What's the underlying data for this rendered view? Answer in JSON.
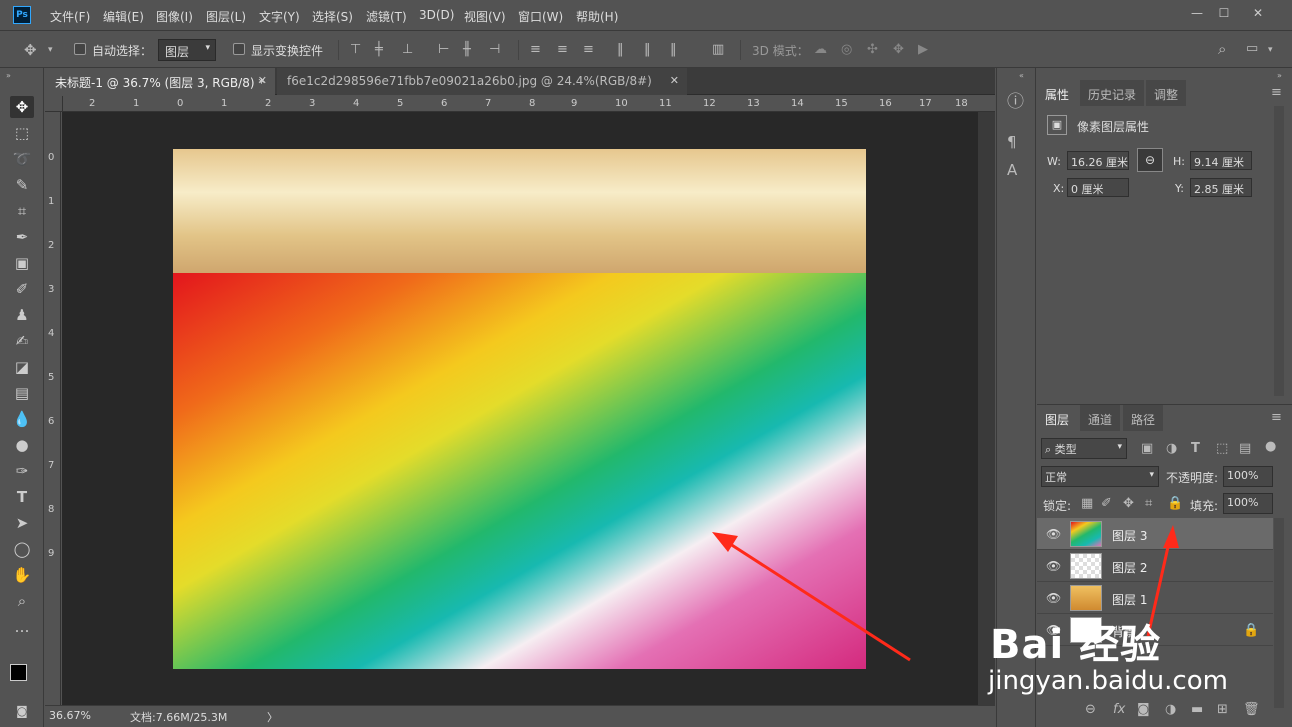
{
  "app": {
    "logo": "Ps"
  },
  "menu": [
    "文件(F)",
    "编辑(E)",
    "图像(I)",
    "图层(L)",
    "文字(Y)",
    "选择(S)",
    "滤镜(T)",
    "3D(D)",
    "视图(V)",
    "窗口(W)",
    "帮助(H)"
  ],
  "window_controls": {
    "minimize": "—",
    "maximize": "☐",
    "close": "✕"
  },
  "options": {
    "auto_select_label": "自动选择：",
    "auto_select_target": "图层",
    "show_transform_label": "显示变换控件",
    "mode3d_label": "3D 模式："
  },
  "tabs": [
    {
      "label": "未标题-1 @ 36.7% (图层 3, RGB/8) *",
      "active": true
    },
    {
      "label": "f6e1c2d298596e71fbb7e09021a26b0.jpg @ 24.4%(RGB/8#)",
      "active": false
    }
  ],
  "ruler_h": [
    "2",
    "1",
    "0",
    "1",
    "2",
    "3",
    "4",
    "5",
    "6",
    "7",
    "8",
    "9",
    "10",
    "11",
    "12",
    "13",
    "14",
    "15",
    "16",
    "17",
    "18"
  ],
  "ruler_v": [
    "0",
    "1",
    "2",
    "3",
    "4",
    "5",
    "6",
    "7",
    "8",
    "9"
  ],
  "status": {
    "zoom": "36.67%",
    "doc": "文档:7.66M/25.3M",
    "arrow": "〉"
  },
  "properties": {
    "tabs": [
      "属性",
      "历史记录",
      "调整"
    ],
    "title": "像素图层属性",
    "w_label": "W:",
    "w": "16.26 厘米",
    "h_label": "H:",
    "h": "9.14 厘米",
    "x_label": "X:",
    "x": "0 厘米",
    "y_label": "Y:",
    "y": "2.85 厘米"
  },
  "layers": {
    "tabs": [
      "图层",
      "通道",
      "路径"
    ],
    "filter": "类型",
    "blend_mode": "正常",
    "opacity_label": "不透明度:",
    "opacity": "100%",
    "lock_label": "锁定:",
    "fill_label": "填充:",
    "fill": "100%",
    "items": [
      {
        "name": "图层 3",
        "selected": true
      },
      {
        "name": "图层 2",
        "selected": false
      },
      {
        "name": "图层 1",
        "selected": false
      },
      {
        "name": "背景",
        "selected": false
      }
    ]
  },
  "watermark": {
    "brand": "Bai 经验",
    "url": "jingyan.baidu.com"
  },
  "icons": [
    "move-icon",
    "marquee-icon",
    "lasso-icon",
    "quick-select-icon",
    "crop-icon",
    "eyedropper-icon",
    "healing-icon",
    "brush-icon",
    "stamp-icon",
    "history-brush-icon",
    "eraser-icon",
    "gradient-icon",
    "blur-icon",
    "dodge-icon",
    "pen-icon",
    "type-icon",
    "path-select-icon",
    "ellipse-icon",
    "hand-icon",
    "zoom-icon",
    "more-icon"
  ],
  "colors": {
    "accent": "#31a8ff",
    "arrow": "#ff2a1a",
    "workspace": "#282828",
    "panel": "#535353"
  }
}
